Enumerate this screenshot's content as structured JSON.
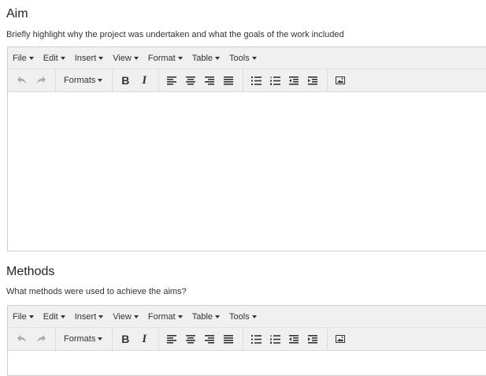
{
  "aim": {
    "heading": "Aim",
    "description": "Briefly highlight why the project was undertaken and what the goals of the work included"
  },
  "methods": {
    "heading": "Methods",
    "description": "What methods were used to achieve the aims?"
  },
  "editor": {
    "menus": [
      "File",
      "Edit",
      "Insert",
      "View",
      "Format",
      "Table",
      "Tools"
    ],
    "formats_label": "Formats"
  }
}
